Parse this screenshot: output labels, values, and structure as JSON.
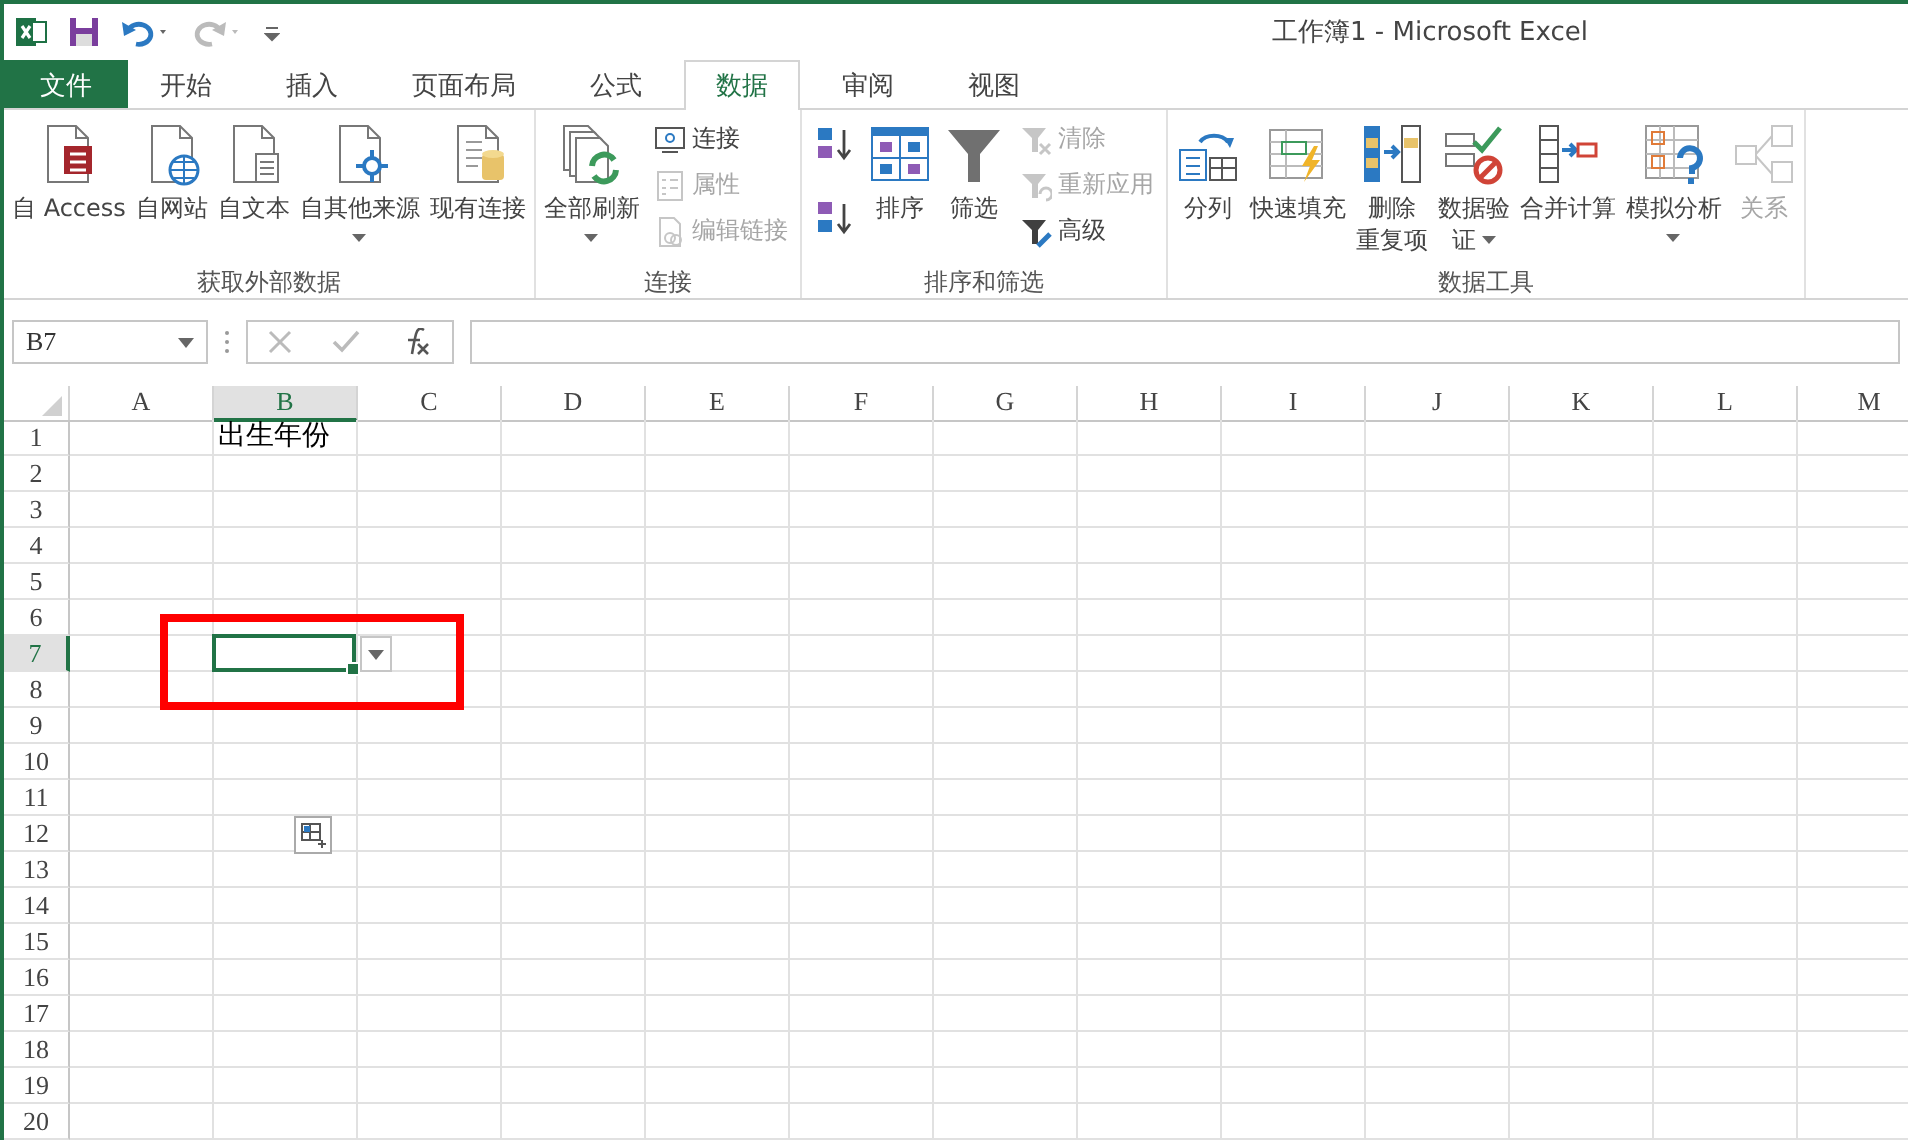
{
  "window": {
    "title": "工作簿1 - Microsoft Excel"
  },
  "tabs": [
    {
      "label": "文件",
      "kind": "file",
      "selected": false
    },
    {
      "label": "开始",
      "kind": "tab",
      "selected": false
    },
    {
      "label": "插入",
      "kind": "tab",
      "selected": false
    },
    {
      "label": "页面布局",
      "kind": "tab",
      "selected": false
    },
    {
      "label": "公式",
      "kind": "tab",
      "selected": false
    },
    {
      "label": "数据",
      "kind": "tab",
      "selected": true
    },
    {
      "label": "审阅",
      "kind": "tab",
      "selected": false
    },
    {
      "label": "视图",
      "kind": "tab",
      "selected": false
    }
  ],
  "ribbon": {
    "groups": [
      {
        "label": "获取外部数据",
        "items": [
          {
            "kind": "large",
            "lines": [
              "自 Access"
            ],
            "dropdown": false,
            "disabled": false
          },
          {
            "kind": "large",
            "lines": [
              "自网站"
            ],
            "dropdown": false,
            "disabled": false
          },
          {
            "kind": "large",
            "lines": [
              "自文本"
            ],
            "dropdown": false,
            "disabled": false
          },
          {
            "kind": "large",
            "lines": [
              "自其他来源"
            ],
            "dropdown": true,
            "disabled": false
          },
          {
            "kind": "large",
            "lines": [
              "现有连接"
            ],
            "dropdown": false,
            "disabled": false
          }
        ]
      },
      {
        "label": "连接",
        "items": [
          {
            "kind": "large",
            "lines": [
              "全部刷新"
            ],
            "dropdown": true,
            "disabled": false
          },
          {
            "kind": "stack",
            "items": [
              {
                "label": "连接",
                "disabled": false
              },
              {
                "label": "属性",
                "disabled": true
              },
              {
                "label": "编辑链接",
                "disabled": true
              }
            ]
          }
        ]
      },
      {
        "label": "排序和筛选",
        "items": [
          {
            "kind": "sort-buttons"
          },
          {
            "kind": "large",
            "lines": [
              "排序"
            ],
            "dropdown": false,
            "disabled": false
          },
          {
            "kind": "large",
            "lines": [
              "筛选"
            ],
            "dropdown": false,
            "disabled": false
          },
          {
            "kind": "stack",
            "items": [
              {
                "label": "清除",
                "disabled": true
              },
              {
                "label": "重新应用",
                "disabled": true
              },
              {
                "label": "高级",
                "disabled": false
              }
            ]
          }
        ]
      },
      {
        "label": "数据工具",
        "items": [
          {
            "kind": "large",
            "lines": [
              "分列"
            ],
            "dropdown": false,
            "disabled": false
          },
          {
            "kind": "large",
            "lines": [
              "快速填充"
            ],
            "dropdown": false,
            "disabled": false
          },
          {
            "kind": "large",
            "lines": [
              "删除",
              "重复项"
            ],
            "dropdown": false,
            "disabled": false
          },
          {
            "kind": "large",
            "lines": [
              "数据验",
              "证"
            ],
            "dropdown": true,
            "disabled": false
          },
          {
            "kind": "large",
            "lines": [
              "合并计算"
            ],
            "dropdown": false,
            "disabled": false
          },
          {
            "kind": "large",
            "lines": [
              "模拟分析"
            ],
            "dropdown": true,
            "disabled": false
          },
          {
            "kind": "large",
            "lines": [
              "关系"
            ],
            "dropdown": false,
            "disabled": true
          }
        ]
      }
    ]
  },
  "formula_bar": {
    "name_box": "B7"
  },
  "sheet": {
    "columns": [
      {
        "label": "A",
        "selected": false
      },
      {
        "label": "B",
        "selected": true
      },
      {
        "label": "C",
        "selected": false
      },
      {
        "label": "D",
        "selected": false
      },
      {
        "label": "E",
        "selected": false
      },
      {
        "label": "F",
        "selected": false
      },
      {
        "label": "G",
        "selected": false
      },
      {
        "label": "H",
        "selected": false
      },
      {
        "label": "I",
        "selected": false
      },
      {
        "label": "J",
        "selected": false
      },
      {
        "label": "K",
        "selected": false
      },
      {
        "label": "L",
        "selected": false
      },
      {
        "label": "M",
        "selected": false
      }
    ],
    "rows": [
      {
        "label": "1",
        "selected": false,
        "cells": {
          "B": "出生年份"
        }
      },
      {
        "label": "2",
        "selected": false
      },
      {
        "label": "3",
        "selected": false
      },
      {
        "label": "4",
        "selected": false
      },
      {
        "label": "5",
        "selected": false
      },
      {
        "label": "6",
        "selected": false
      },
      {
        "label": "7",
        "selected": true,
        "validation_dropdown": true
      },
      {
        "label": "8",
        "selected": false
      },
      {
        "label": "9",
        "selected": false
      },
      {
        "label": "10",
        "selected": false
      },
      {
        "label": "11",
        "selected": false
      },
      {
        "label": "12",
        "selected": false,
        "quick_analysis": true
      },
      {
        "label": "13",
        "selected": false
      },
      {
        "label": "14",
        "selected": false
      },
      {
        "label": "15",
        "selected": false
      },
      {
        "label": "16",
        "selected": false
      },
      {
        "label": "17",
        "selected": false
      },
      {
        "label": "18",
        "selected": false
      },
      {
        "label": "19",
        "selected": false
      },
      {
        "label": "20",
        "selected": false
      }
    ],
    "annotation": {
      "kind": "rectangle",
      "color": "#ff0000"
    }
  }
}
